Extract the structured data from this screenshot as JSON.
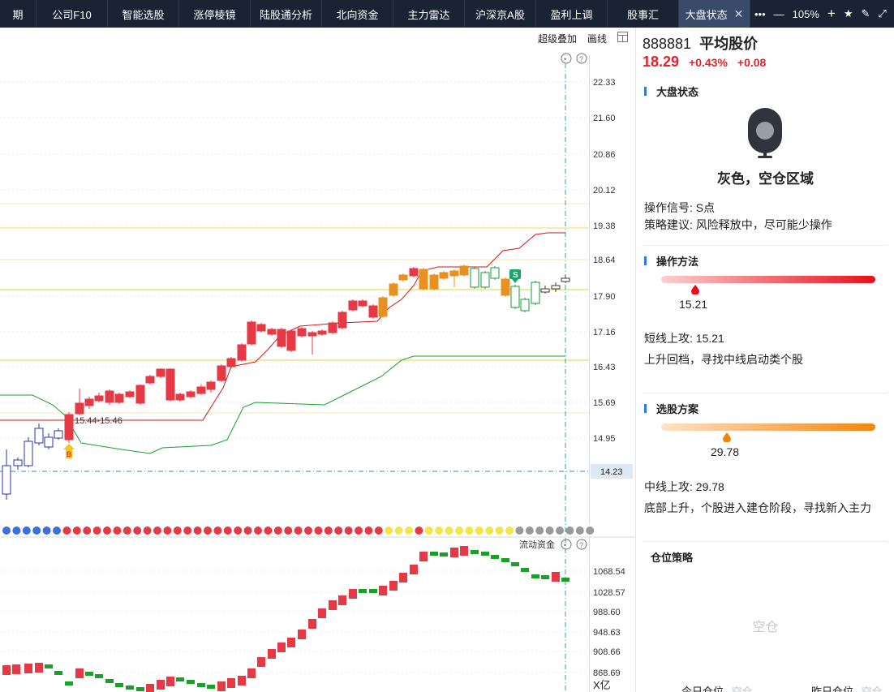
{
  "tabs": [
    {
      "label": "期",
      "w": 45
    },
    {
      "label": "公司F10",
      "w": 88
    },
    {
      "label": "智能选股",
      "w": 88
    },
    {
      "label": "涨停棱镜",
      "w": 88
    },
    {
      "label": "陆股通分析",
      "w": 88
    },
    {
      "label": "北向资金",
      "w": 88
    },
    {
      "label": "主力雷达",
      "w": 88
    },
    {
      "label": "沪深京A股",
      "w": 88
    },
    {
      "label": "盈利上调",
      "w": 88
    },
    {
      "label": "股事汇",
      "w": 88
    },
    {
      "label": "大盘状态",
      "w": 88,
      "active": true
    }
  ],
  "window_controls": {
    "more": "•••",
    "minimize": "—",
    "zoom": "105%",
    "zoom_in": "+",
    "favorite": "★",
    "edit": "✎",
    "expand": "⤢"
  },
  "toolbar": {
    "overlay_label": "超级叠加",
    "draw_label": "画线"
  },
  "main_chart": {
    "y_ticks": [
      "22.33",
      "21.60",
      "20.86",
      "20.12",
      "19.38",
      "18.64",
      "17.90",
      "17.16",
      "16.43",
      "15.69",
      "14.95"
    ],
    "current_price_label": "14.23",
    "annotation": "15.44-15.46",
    "buy_marker": "B",
    "sell_marker": "S"
  },
  "sub_chart": {
    "title": "流动资金",
    "y_ticks": [
      "1068.54",
      "1028.57",
      "988.60",
      "948.63",
      "908.66",
      "868.69"
    ],
    "unit": "X亿"
  },
  "stock": {
    "code": "888881",
    "name": "平均股价",
    "price": "18.29",
    "pct": "+0.43%",
    "chg": "+0.08",
    "up_color": "#e8202a"
  },
  "market_status": {
    "heading": "大盘状态",
    "status_text": "灰色，空仓区域",
    "signal": "操作信号: S点",
    "advice": "策略建议: 风险释放中，尽可能少操作"
  },
  "operation": {
    "heading": "操作方法",
    "gauge_value": "15.21",
    "line1": "短线上攻: 15.21",
    "line2": "上升回档，寻找中线启动类个股"
  },
  "selection": {
    "heading": "选股方案",
    "gauge_value": "29.78",
    "line1": "中线上攻: 29.78",
    "line2": "底部上升，个股进入建仓阶段，寻找新入主力"
  },
  "position": {
    "heading": "仓位策略",
    "state": "空仓",
    "today_label": "今日仓位",
    "today_value": "空仓",
    "yesterday_label": "昨日仓位",
    "yesterday_value": "空仓"
  }
}
